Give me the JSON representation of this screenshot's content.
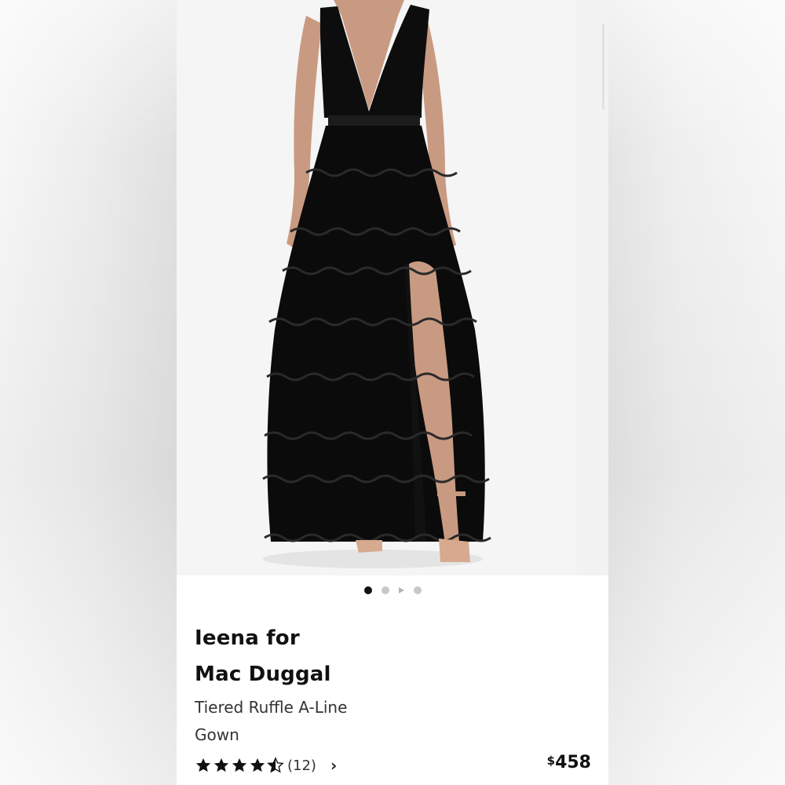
{
  "product": {
    "brand_line1": "Ieena for",
    "brand_line2": "Mac Duggal",
    "name": "Tiered Ruffle A-Line Gown",
    "rating": 4.5,
    "review_count": "(12)",
    "price_currency": "$",
    "price_amount": "458"
  },
  "carousel": {
    "slides": 4,
    "active_index": 0,
    "video_slide_index": 2
  },
  "icons": {
    "star": "star-icon",
    "chevron": "chevron-right-icon",
    "play": "play-icon"
  },
  "colors": {
    "dress": "#0b0b0b",
    "skin": "#c99a82",
    "dot_active": "#111111",
    "dot_inactive": "#c8c8c8"
  }
}
